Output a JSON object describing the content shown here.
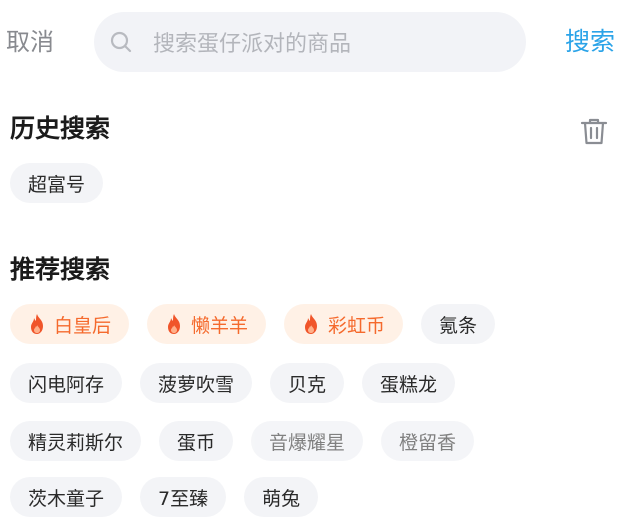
{
  "topbar": {
    "cancel_label": "取消",
    "search_placeholder": "搜索蛋仔派对的商品",
    "search_label": "搜索"
  },
  "history": {
    "title": "历史搜索",
    "items": [
      "超富号"
    ]
  },
  "recommended": {
    "title": "推荐搜索",
    "rows": [
      [
        {
          "label": "白皇后",
          "hot": true
        },
        {
          "label": "懒羊羊",
          "hot": true
        },
        {
          "label": "彩虹币",
          "hot": true
        },
        {
          "label": "氪条",
          "hot": false
        }
      ],
      [
        {
          "label": "闪电阿存",
          "hot": false
        },
        {
          "label": "菠萝吹雪",
          "hot": false
        },
        {
          "label": "贝克",
          "hot": false
        },
        {
          "label": "蛋糕龙",
          "hot": false
        }
      ],
      [
        {
          "label": "精灵莉斯尔",
          "hot": false
        },
        {
          "label": "蛋币",
          "hot": false
        },
        {
          "label": "音爆耀星",
          "hot": false
        },
        {
          "label": "橙留香",
          "hot": false
        }
      ],
      [
        {
          "label": "茨木童子",
          "hot": false
        },
        {
          "label": "7至臻",
          "hot": false
        },
        {
          "label": "萌兔",
          "hot": false
        }
      ]
    ]
  },
  "colors": {
    "accent": "#2aa3e8",
    "hot_text": "#f56a2d",
    "hot_bg": "#fff1e6",
    "chip_bg": "#f3f4f7"
  },
  "icons": {
    "search": "search-icon",
    "trash": "trash-icon",
    "hot": "fire-icon"
  }
}
